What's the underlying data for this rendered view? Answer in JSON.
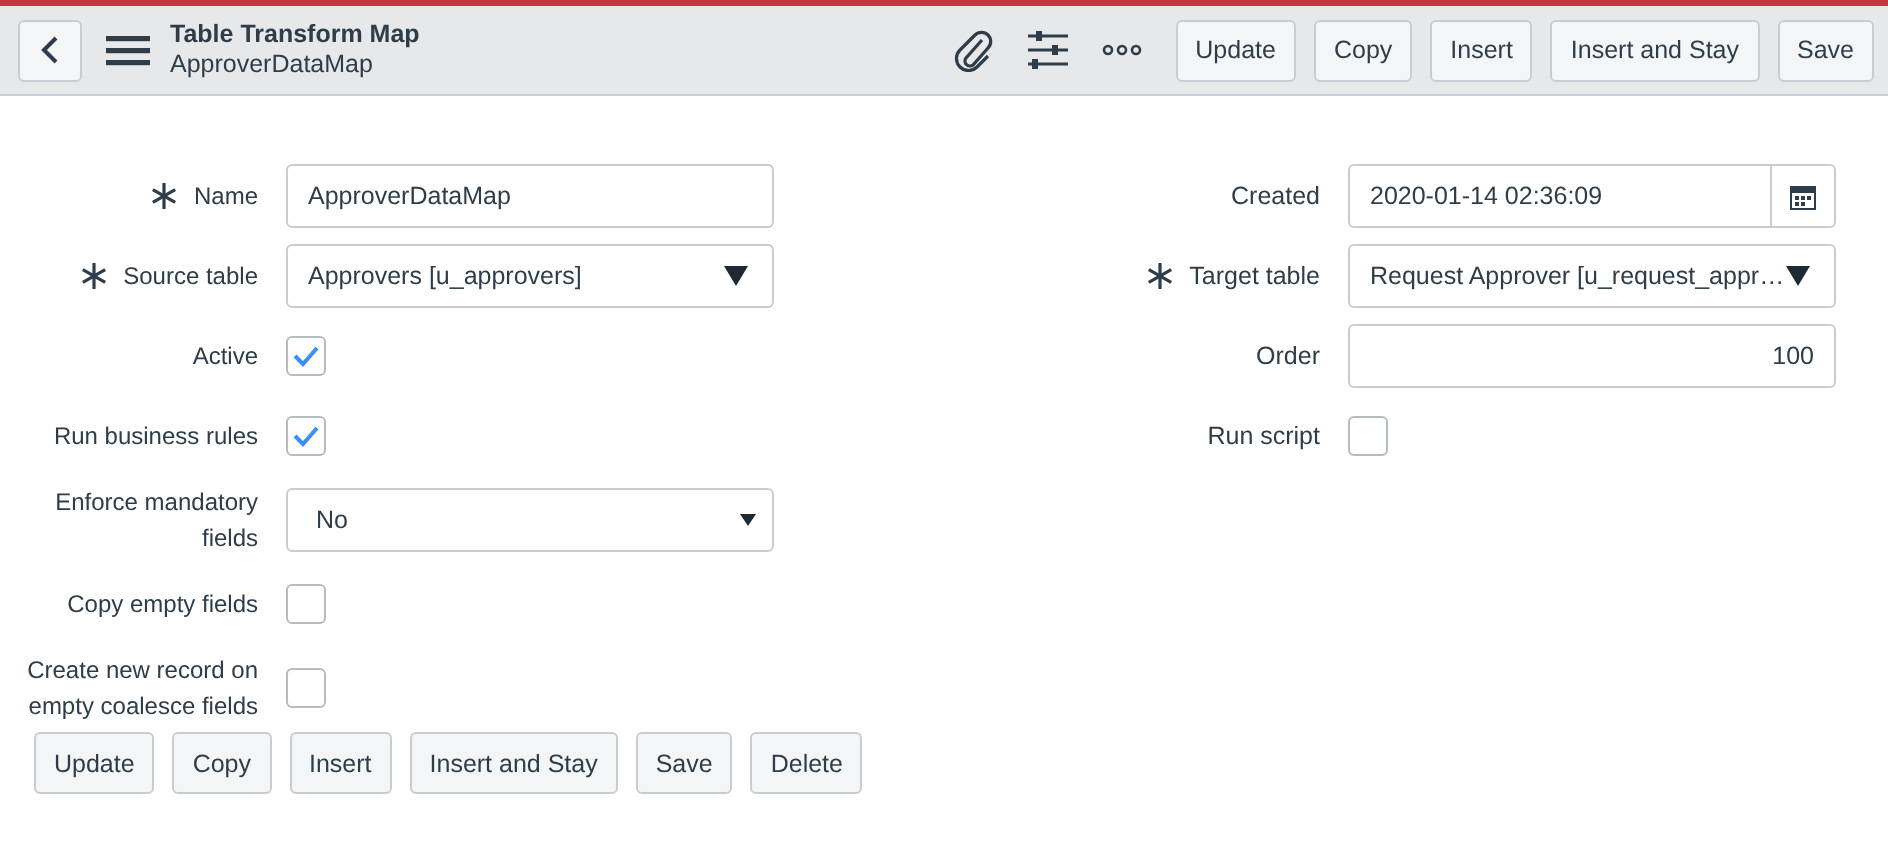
{
  "header": {
    "title": "Table Transform Map",
    "subtitle": "ApproverDataMap",
    "buttons": [
      "Update",
      "Copy",
      "Insert",
      "Insert and Stay",
      "Save"
    ]
  },
  "left_fields": [
    {
      "label": "Name",
      "required": true,
      "kind": "text",
      "value": "ApproverDataMap"
    },
    {
      "label": "Source table",
      "required": true,
      "kind": "select",
      "value": "Approvers [u_approvers]"
    },
    {
      "label": "Active",
      "required": false,
      "kind": "checkbox",
      "checked": true
    },
    {
      "label": "Run business rules",
      "required": false,
      "kind": "checkbox",
      "checked": true
    },
    {
      "label": "Enforce mandatory fields",
      "required": false,
      "kind": "choice",
      "value": "No"
    },
    {
      "label": "Copy empty fields",
      "required": false,
      "kind": "checkbox",
      "checked": false
    },
    {
      "label": "Create new record on empty coalesce fields",
      "required": false,
      "kind": "checkbox",
      "checked": false
    }
  ],
  "right_fields": [
    {
      "label": "Created",
      "required": false,
      "kind": "date",
      "value": "2020-01-14 02:36:09"
    },
    {
      "label": "Target table",
      "required": true,
      "kind": "select",
      "value": "Request Approver [u_request_appr…"
    },
    {
      "label": "Order",
      "required": false,
      "kind": "number",
      "value": "100"
    },
    {
      "label": "Run script",
      "required": false,
      "kind": "checkbox",
      "checked": false
    }
  ],
  "footer_buttons": [
    "Update",
    "Copy",
    "Insert",
    "Insert and Stay",
    "Save",
    "Delete"
  ]
}
